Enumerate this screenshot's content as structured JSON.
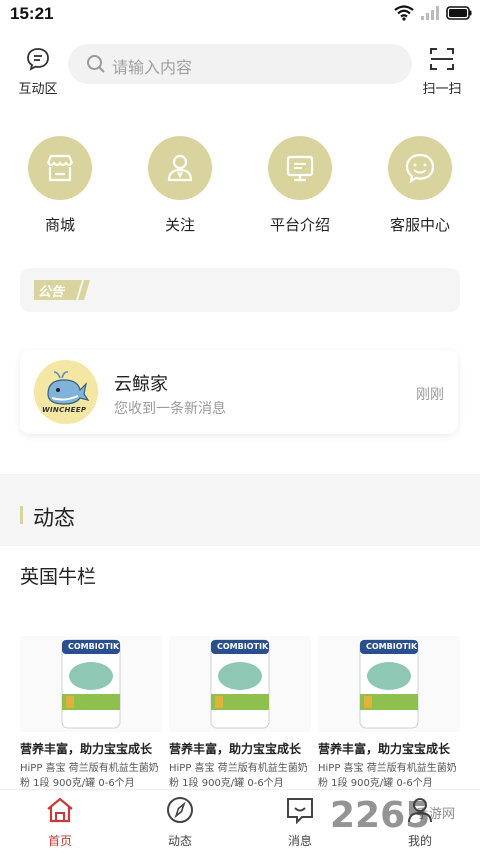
{
  "status_bar": {
    "time": "15:21"
  },
  "header": {
    "left_label": "互动区",
    "search_placeholder": "请输入内容",
    "right_label": "扫一扫"
  },
  "quick_actions": [
    {
      "label": "商城",
      "icon": "store-icon"
    },
    {
      "label": "关注",
      "icon": "person-icon"
    },
    {
      "label": "平台介绍",
      "icon": "monitor-icon"
    },
    {
      "label": "客服中心",
      "icon": "smile-chat-icon"
    }
  ],
  "notice": {
    "tag": "公告"
  },
  "message": {
    "name": "云鲸家",
    "text": "您收到一条新消息",
    "time": "刚刚",
    "avatar_text": "WINCHEEP"
  },
  "section": {
    "title": "动态",
    "sub": "英国牛栏"
  },
  "products": [
    {
      "title": "营养丰富，助力宝宝成长",
      "desc": "HiPP 喜宝 荷兰版有机益生菌奶粉 1段 900克/罐 0-6个月",
      "brand": "COMBIOTIK"
    },
    {
      "title": "营养丰富，助力宝宝成长",
      "desc": "HiPP 喜宝 荷兰版有机益生菌奶粉 1段 900克/罐 0-6个月",
      "brand": "COMBIOTIK"
    },
    {
      "title": "营养丰富，助力宝宝成长",
      "desc": "HiPP 喜宝 荷兰版有机益生菌奶粉 1段 900克/罐 0-6个月",
      "brand": "COMBIOTIK"
    }
  ],
  "tabbar": [
    {
      "label": "首页",
      "active": true
    },
    {
      "label": "动态",
      "active": false
    },
    {
      "label": "消息",
      "active": false
    },
    {
      "label": "我的",
      "active": false
    }
  ],
  "watermark": {
    "main": "2265",
    "side": "手游网"
  },
  "colors": {
    "accent": "#d9d49e",
    "active_tab": "#c83a3a"
  }
}
